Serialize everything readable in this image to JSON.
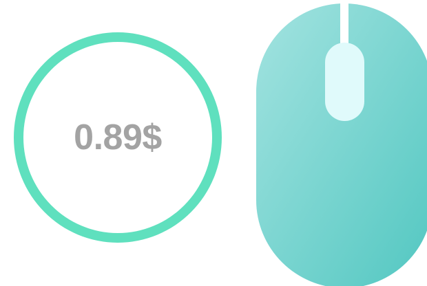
{
  "price": {
    "value": "0.89$",
    "text_color": "#a3a3a3",
    "ring_color": "#5fe0be"
  },
  "mouse": {
    "icon": "computer-mouse-icon",
    "gradient_start": "#a3e3e0",
    "gradient_end": "#52c7c1",
    "wheel_color": "#e0fafb"
  }
}
